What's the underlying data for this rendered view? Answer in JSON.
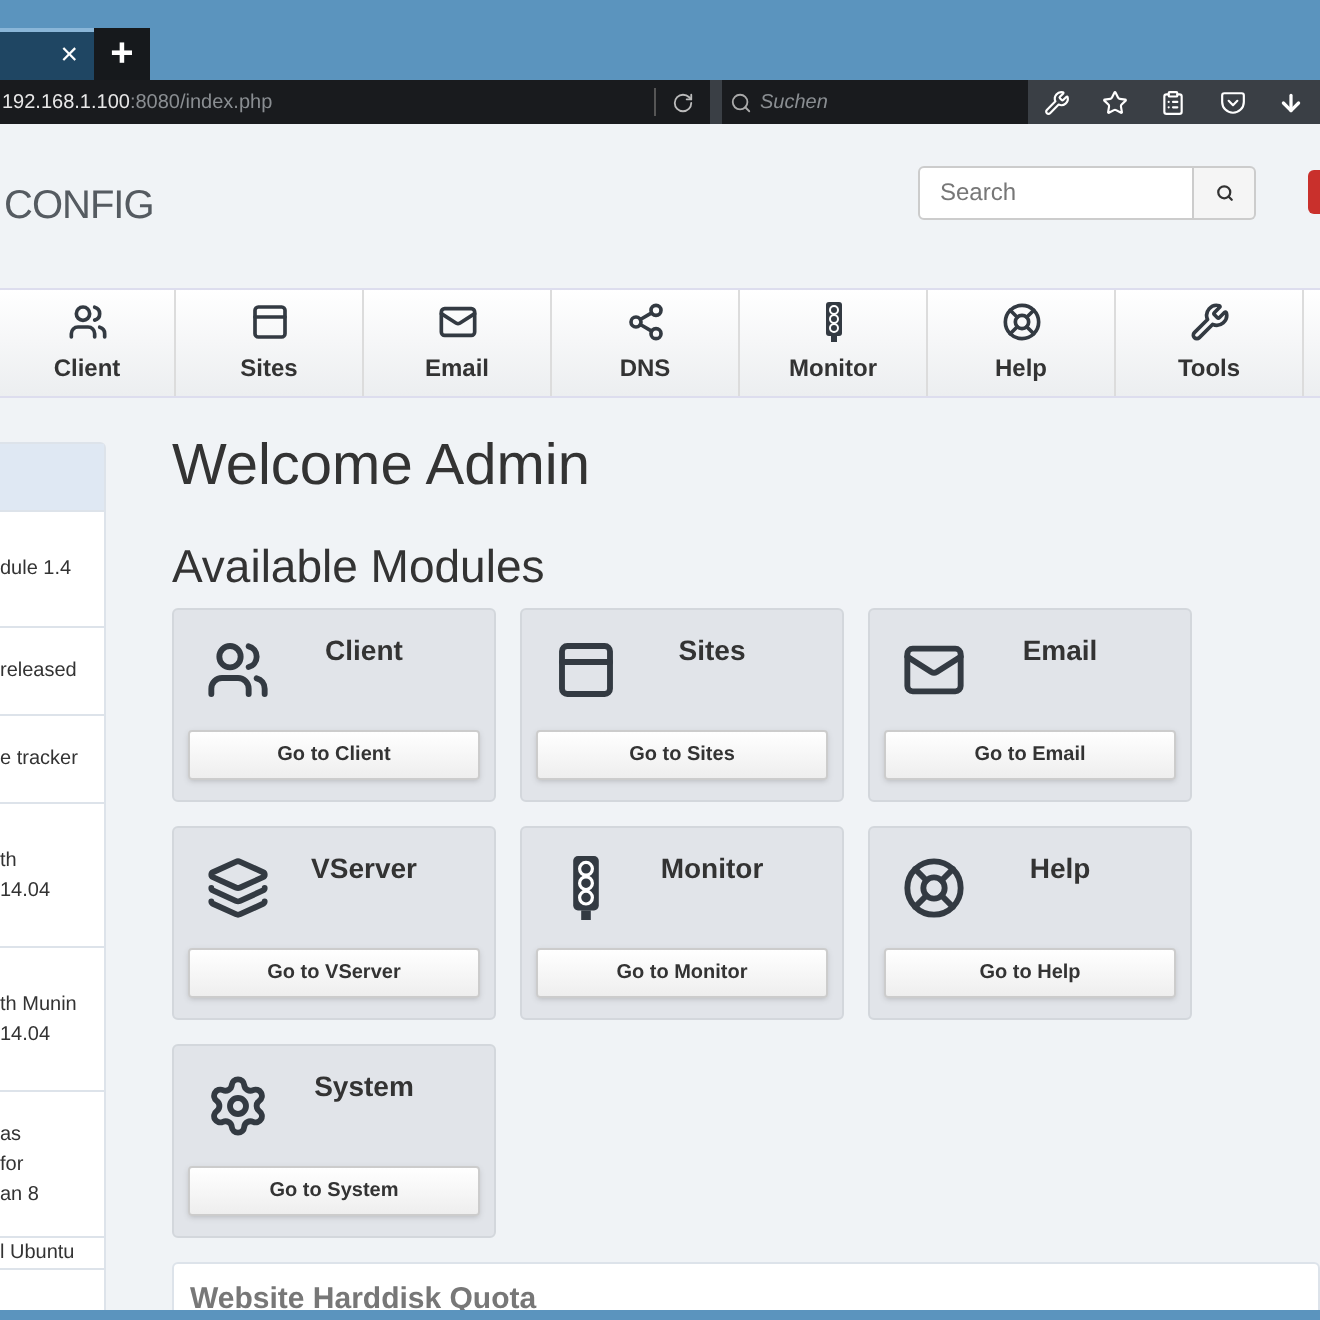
{
  "browser": {
    "tab_close": "×",
    "new_tab": "+",
    "url_host": "192.168.1.100",
    "url_rest": ":8080/index.php",
    "search_placeholder": "Suchen"
  },
  "header": {
    "logo": "CONFIG",
    "search_placeholder": "Search"
  },
  "nav": [
    {
      "label": "Client",
      "kind": "client",
      "selected": false
    },
    {
      "label": "Sites",
      "kind": "sites",
      "selected": false
    },
    {
      "label": "Email",
      "kind": "email",
      "selected": false
    },
    {
      "label": "DNS",
      "kind": "dns",
      "selected": false
    },
    {
      "label": "Monitor",
      "kind": "monitor",
      "selected": false
    },
    {
      "label": "Help",
      "kind": "help",
      "selected": false
    },
    {
      "label": "Tools",
      "kind": "tools",
      "selected": false
    }
  ],
  "sidebar": {
    "items": [
      {
        "selected": true
      },
      {
        "lines": [
          "dule 1.4"
        ],
        "selected": false
      },
      {
        "lines": [
          "released"
        ],
        "selected": false
      },
      {
        "lines": [
          "e tracker"
        ],
        "selected": false
      },
      {
        "lines": [
          "th",
          "14.04"
        ],
        "selected": false
      },
      {
        "lines": [
          "th Munin",
          "14.04"
        ],
        "selected": false
      },
      {
        "lines": [
          "as",
          "for",
          "an 8"
        ],
        "selected": false
      },
      {
        "lines": [
          "l Ubuntu"
        ],
        "selected": false
      }
    ]
  },
  "title": "Welcome Admin",
  "modules_heading": "Available Modules",
  "modules": [
    {
      "name": "Client",
      "kind": "client",
      "button": "Go to Client"
    },
    {
      "name": "Sites",
      "kind": "sites",
      "button": "Go to Sites"
    },
    {
      "name": "Email",
      "kind": "email",
      "button": "Go to Email"
    },
    {
      "name": "VServer",
      "kind": "vserver",
      "button": "Go to VServer"
    },
    {
      "name": "Monitor",
      "kind": "monitor",
      "button": "Go to Monitor"
    },
    {
      "name": "Help",
      "kind": "help",
      "button": "Go to Help"
    },
    {
      "name": "System",
      "kind": "system",
      "button": "Go to System"
    }
  ],
  "quota_heading": "Website Harddisk Quota"
}
